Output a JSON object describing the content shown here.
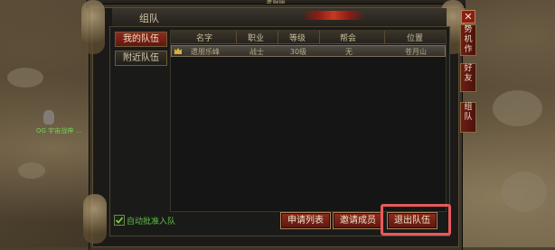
{
  "window": {
    "top_title": "老限缓",
    "title": "组队"
  },
  "left_tabs": [
    {
      "label": "我的队伍",
      "active": true
    },
    {
      "label": "附近队伍",
      "active": false
    }
  ],
  "table": {
    "columns": [
      "名字",
      "职业",
      "等级",
      "帮会",
      "位置"
    ],
    "rows": [
      {
        "name": "遗朋乐峰",
        "class": "战士",
        "level": "30级",
        "guild": "无",
        "location": "苍月山"
      }
    ]
  },
  "auto_approve": {
    "label": "自动批准入队",
    "checked": true
  },
  "buttons": {
    "apply_list": "申请列表",
    "invite": "邀请成员",
    "leave": "退出队伍"
  },
  "side_tabs": {
    "close": "✕",
    "tab1": "势 机 作",
    "tab2": "好 友",
    "tab3": "组 队"
  },
  "map": {
    "player_name": "OG 宇宙战神 ..."
  },
  "colors": {
    "accent_red": "#8e2a1d",
    "highlight": "#e85a5a",
    "label_green": "#5fbf44"
  }
}
